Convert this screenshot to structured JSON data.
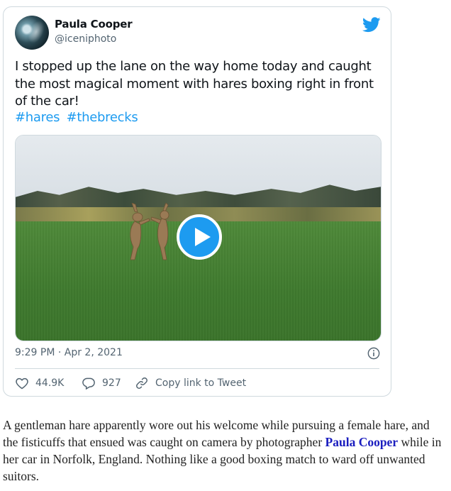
{
  "tweet": {
    "display_name": "Paula Cooper",
    "handle": "@iceniphoto",
    "text": "I stopped up the lane on the way home today and caught the most magical moment with hares boxing right in front of the car!",
    "hashtags": [
      "#hares",
      "#thebrecks"
    ],
    "timestamp": "9:29 PM · Apr 2, 2021",
    "likes": "44.9K",
    "replies": "927",
    "copy_link_label": "Copy link to Tweet",
    "accent_color": "#1d9bf0"
  },
  "article": {
    "caption_part1": "A gentleman hare apparently wore out his welcome while pursuing a female hare, and the fisticuffs that ensued was caught on camera by photographer ",
    "caption_link": "Paula Cooper",
    "caption_part2": " while in her car in Norfolk, England. Nothing like a good boxing match to ward off unwanted suitors."
  }
}
